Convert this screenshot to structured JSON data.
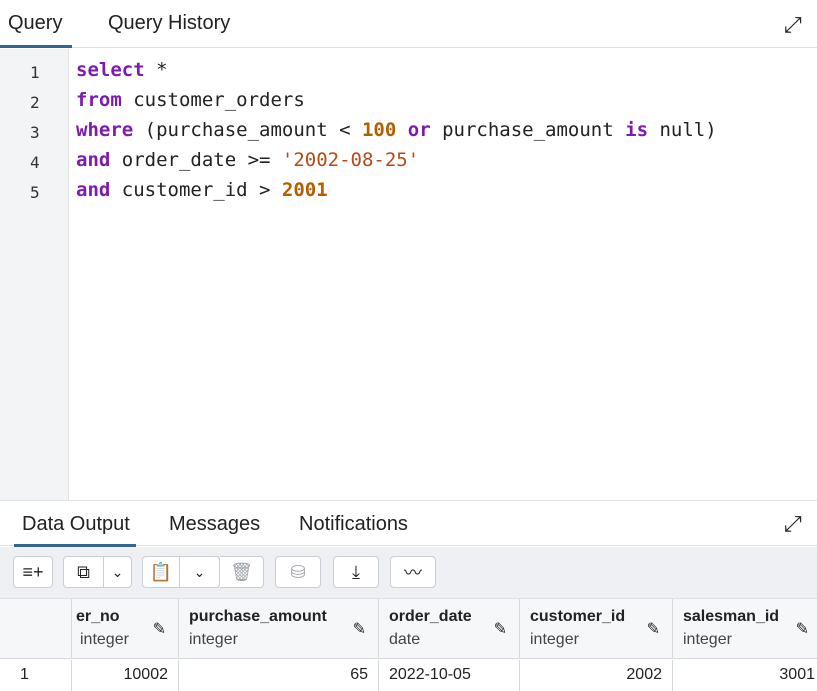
{
  "query_tabs": {
    "query": "Query",
    "history": "Query History"
  },
  "icons": {
    "expand": "expand-icon",
    "pencil": "pencil-icon"
  },
  "editor": {
    "line_numbers": [
      "1",
      "2",
      "3",
      "4",
      "5"
    ],
    "lines": [
      [
        {
          "t": "select",
          "c": "kw"
        },
        {
          "t": " *",
          "c": ""
        }
      ],
      [
        {
          "t": "from",
          "c": "kw"
        },
        {
          "t": " customer_orders",
          "c": ""
        }
      ],
      [
        {
          "t": "where",
          "c": "kw"
        },
        {
          "t": " (purchase_amount < ",
          "c": ""
        },
        {
          "t": "100",
          "c": "num"
        },
        {
          "t": " ",
          "c": ""
        },
        {
          "t": "or",
          "c": "kw"
        },
        {
          "t": " purchase_amount ",
          "c": ""
        },
        {
          "t": "is",
          "c": "kw"
        },
        {
          "t": " null)",
          "c": ""
        }
      ],
      [
        {
          "t": "and",
          "c": "kw"
        },
        {
          "t": " order_date >= ",
          "c": ""
        },
        {
          "t": "'2002-08-25'",
          "c": "str"
        }
      ],
      [
        {
          "t": "and",
          "c": "kw"
        },
        {
          "t": " customer_id > ",
          "c": ""
        },
        {
          "t": "2001",
          "c": "num"
        }
      ]
    ]
  },
  "output_tabs": {
    "data_output": "Data Output",
    "messages": "Messages",
    "notifications": "Notifications"
  },
  "toolbar": {
    "add_row": "≡+",
    "copy": "⧉",
    "copy_caret": "⌄",
    "paste": "📋",
    "paste_caret": "⌄",
    "delete": "🗑",
    "save_data": "⛁",
    "download": "⤓",
    "graph": "〰"
  },
  "grid": {
    "columns": [
      {
        "name": "er_no",
        "type": "integer"
      },
      {
        "name": "purchase_amount",
        "type": "integer"
      },
      {
        "name": "order_date",
        "type": "date"
      },
      {
        "name": "customer_id",
        "type": "integer"
      },
      {
        "name": "salesman_id",
        "type": "integer"
      }
    ],
    "rows": [
      {
        "row_num": "1",
        "cells": [
          "10002",
          "65",
          "2022-10-05",
          "2002",
          "3001"
        ]
      }
    ]
  }
}
